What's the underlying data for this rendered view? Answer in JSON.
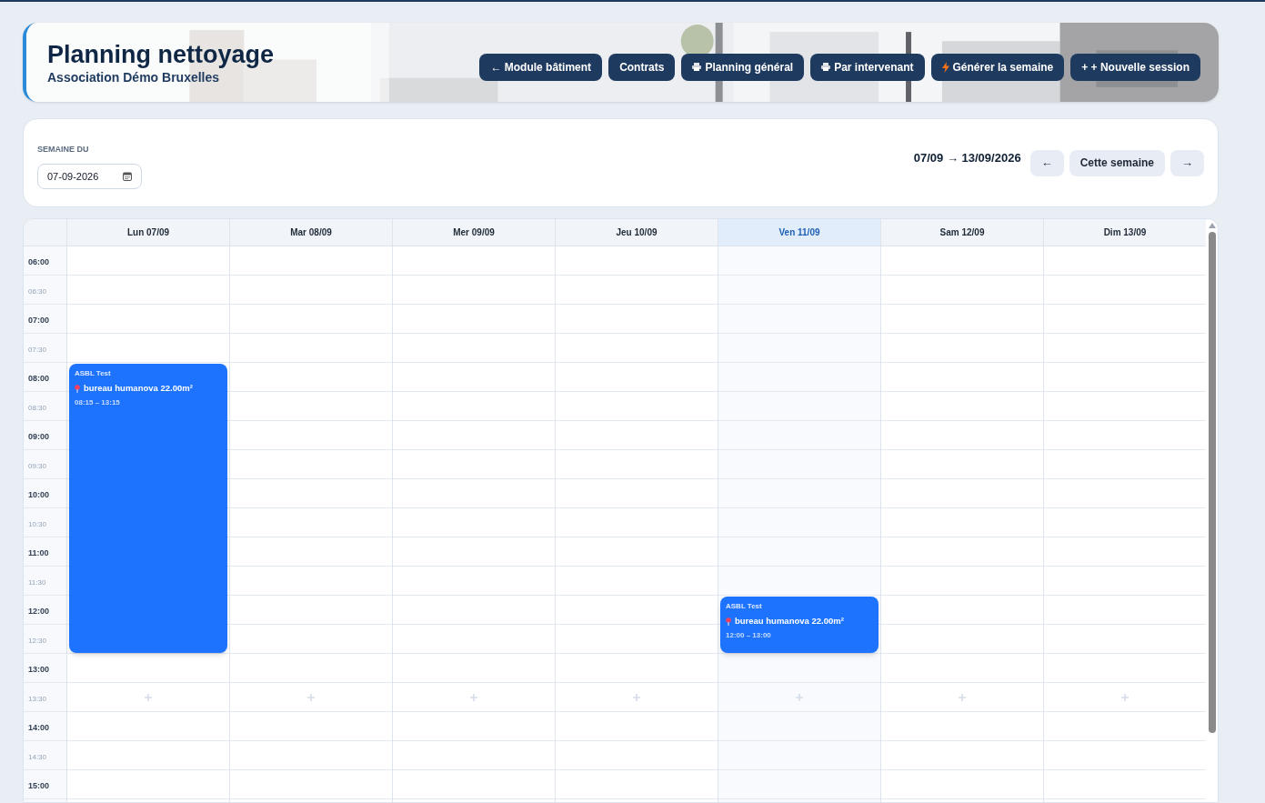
{
  "header": {
    "title": "Planning nettoyage",
    "subtitle": "Association Démo Bruxelles",
    "buttons": [
      {
        "label": "← Module bâtiment",
        "kind": "plain"
      },
      {
        "label": "Contrats",
        "kind": "plain"
      },
      {
        "label": "Planning général",
        "kind": "printer"
      },
      {
        "label": "Par intervenant",
        "kind": "printer"
      },
      {
        "label": "Générer la semaine",
        "kind": "bolt"
      },
      {
        "label": "+ + Nouvelle session",
        "kind": "plain"
      }
    ]
  },
  "week": {
    "label": "SEMAINE DU",
    "value": "07-09-2026",
    "range": "07/09 → 13/09/2026",
    "prev": "←",
    "current": "Cette semaine",
    "next": "→"
  },
  "calendar": {
    "days": [
      {
        "label": "Lun 07/09",
        "today": false,
        "events": [
          {
            "title": "ASBL Test",
            "location": "bureau humanova 22.00m²",
            "time": "08:15 – 13:15"
          }
        ]
      },
      {
        "label": "Mar 08/09",
        "today": false
      },
      {
        "label": "Mer 09/09",
        "today": false
      },
      {
        "label": "Jeu 10/09",
        "today": false
      },
      {
        "label": "Ven 11/09",
        "today": true,
        "events": [
          {
            "title": "ASBL Test",
            "location": "bureau humanova 22.00m²",
            "time": "12:00 – 13:00"
          }
        ]
      },
      {
        "label": "Sam 12/09",
        "today": false
      },
      {
        "label": "Dim 13/09",
        "today": false
      }
    ],
    "slots": [
      {
        "time": "06:00",
        "major": true
      },
      {
        "time": "06:30",
        "major": false
      },
      {
        "time": "07:00",
        "major": true
      },
      {
        "time": "07:30",
        "major": false
      },
      {
        "time": "08:00",
        "major": true
      },
      {
        "time": "08:30",
        "major": false
      },
      {
        "time": "09:00",
        "major": true
      },
      {
        "time": "09:30",
        "major": false
      },
      {
        "time": "10:00",
        "major": true
      },
      {
        "time": "10:30",
        "major": false
      },
      {
        "time": "11:00",
        "major": true
      },
      {
        "time": "11:30",
        "major": false
      },
      {
        "time": "12:00",
        "major": true
      },
      {
        "time": "12:30",
        "major": false
      },
      {
        "time": "13:00",
        "major": true
      },
      {
        "time": "13:30",
        "major": false
      },
      {
        "time": "14:00",
        "major": true
      },
      {
        "time": "14:30",
        "major": false
      },
      {
        "time": "15:00",
        "major": true
      }
    ]
  }
}
